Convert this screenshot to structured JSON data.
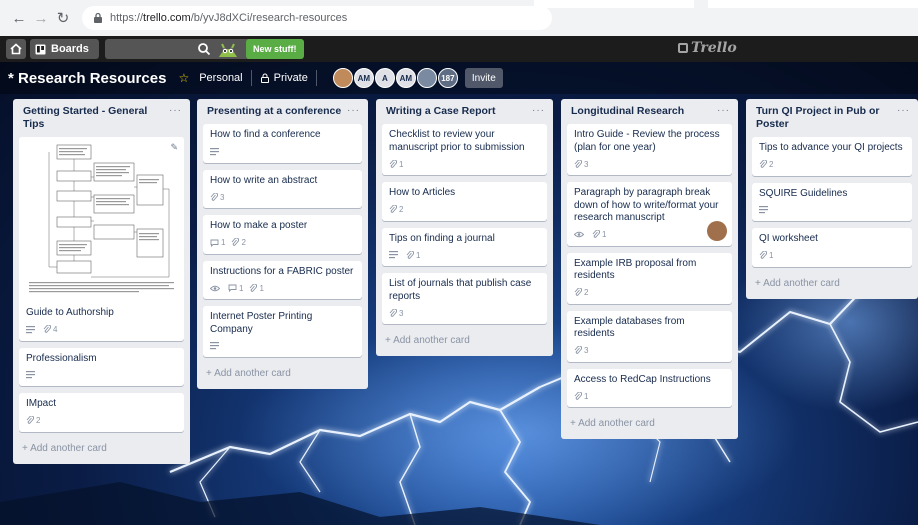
{
  "browser": {
    "url_prefix": "https://",
    "url_host": "trello.com",
    "url_path": "/b/yvJ8dXCi/research-resources"
  },
  "header": {
    "boards_label": "Boards",
    "new_stuff_label": "New stuff!",
    "logo_text": "Trello"
  },
  "board": {
    "title": "* Research Resources",
    "visibility_team": "Personal",
    "visibility": "Private",
    "members": [
      "AM",
      "A",
      "AM"
    ],
    "member_count": "187",
    "invite_label": "Invite"
  },
  "lists": [
    {
      "title": "Getting Started - General Tips",
      "add_card": "+ Add another card",
      "cards": [
        {
          "title": "Guide to Authorship",
          "desc": true,
          "attachments": "4",
          "comments": null,
          "watch": false,
          "image": true
        },
        {
          "title": "Professionalism",
          "desc": true,
          "attachments": null,
          "comments": null,
          "watch": false
        },
        {
          "title": "IMpact",
          "desc": false,
          "attachments": "2",
          "comments": null,
          "watch": false
        }
      ]
    },
    {
      "title": "Presenting at a conference",
      "add_card": "+ Add another card",
      "cards": [
        {
          "title": "How to find a conference",
          "desc": true,
          "attachments": null,
          "comments": null,
          "watch": false
        },
        {
          "title": "How to write an abstract",
          "desc": false,
          "attachments": "3",
          "comments": null,
          "watch": false
        },
        {
          "title": "How to make a poster",
          "desc": false,
          "attachments": "2",
          "comments": "1",
          "watch": false
        },
        {
          "title": "Instructions for a FABRIC poster",
          "desc": false,
          "attachments": "1",
          "comments": "1",
          "watch": true
        },
        {
          "title": "Internet Poster Printing Company",
          "desc": true,
          "attachments": null,
          "comments": null,
          "watch": false
        }
      ]
    },
    {
      "title": "Writing a Case Report",
      "add_card": "+ Add another card",
      "cards": [
        {
          "title": "Checklist to review your manuscript prior to submission",
          "desc": false,
          "attachments": "1",
          "comments": null,
          "watch": false
        },
        {
          "title": "How to Articles",
          "desc": false,
          "attachments": "2",
          "comments": null,
          "watch": false
        },
        {
          "title": "Tips on finding a journal",
          "desc": true,
          "attachments": "1",
          "comments": null,
          "watch": false
        },
        {
          "title": "List of journals that publish case reports",
          "desc": false,
          "attachments": "3",
          "comments": null,
          "watch": false
        }
      ]
    },
    {
      "title": "Longitudinal Research",
      "add_card": "+ Add another card",
      "cards": [
        {
          "title": "Intro Guide - Review the process (plan for one year)",
          "desc": false,
          "attachments": "3",
          "comments": null,
          "watch": false
        },
        {
          "title": "Paragraph by paragraph break down of how to write/format your research manuscript",
          "desc": false,
          "attachments": "1",
          "comments": null,
          "watch": true,
          "avatar": true
        },
        {
          "title": "Example IRB proposal from residents",
          "desc": false,
          "attachments": "2",
          "comments": null,
          "watch": false
        },
        {
          "title": "Example databases from residents",
          "desc": false,
          "attachments": "3",
          "comments": null,
          "watch": false
        },
        {
          "title": "Access to RedCap Instructions",
          "desc": false,
          "attachments": "1",
          "comments": null,
          "watch": false
        }
      ]
    },
    {
      "title": "Turn QI Project in Pub or Poster",
      "add_card": "+ Add another card",
      "cards": [
        {
          "title": "Tips to advance your QI projects",
          "desc": false,
          "attachments": "2",
          "comments": null,
          "watch": false
        },
        {
          "title": "SQUIRE Guidelines",
          "desc": true,
          "attachments": null,
          "comments": null,
          "watch": false
        },
        {
          "title": "QI worksheet",
          "desc": false,
          "attachments": "1",
          "comments": null,
          "watch": false
        }
      ]
    }
  ],
  "icons": {
    "home": "home-icon",
    "boards": "boards-icon",
    "search": "search-icon",
    "star": "star-icon",
    "lock": "lock-icon",
    "description": "description-icon",
    "attachment": "paperclip-icon",
    "comment": "comment-icon",
    "watch": "eye-icon"
  },
  "colors": {
    "header_bg": "#1c1c1c",
    "list_bg": "#ebecf0",
    "new_stuff": "#5aac44",
    "star": "#f2d600"
  }
}
